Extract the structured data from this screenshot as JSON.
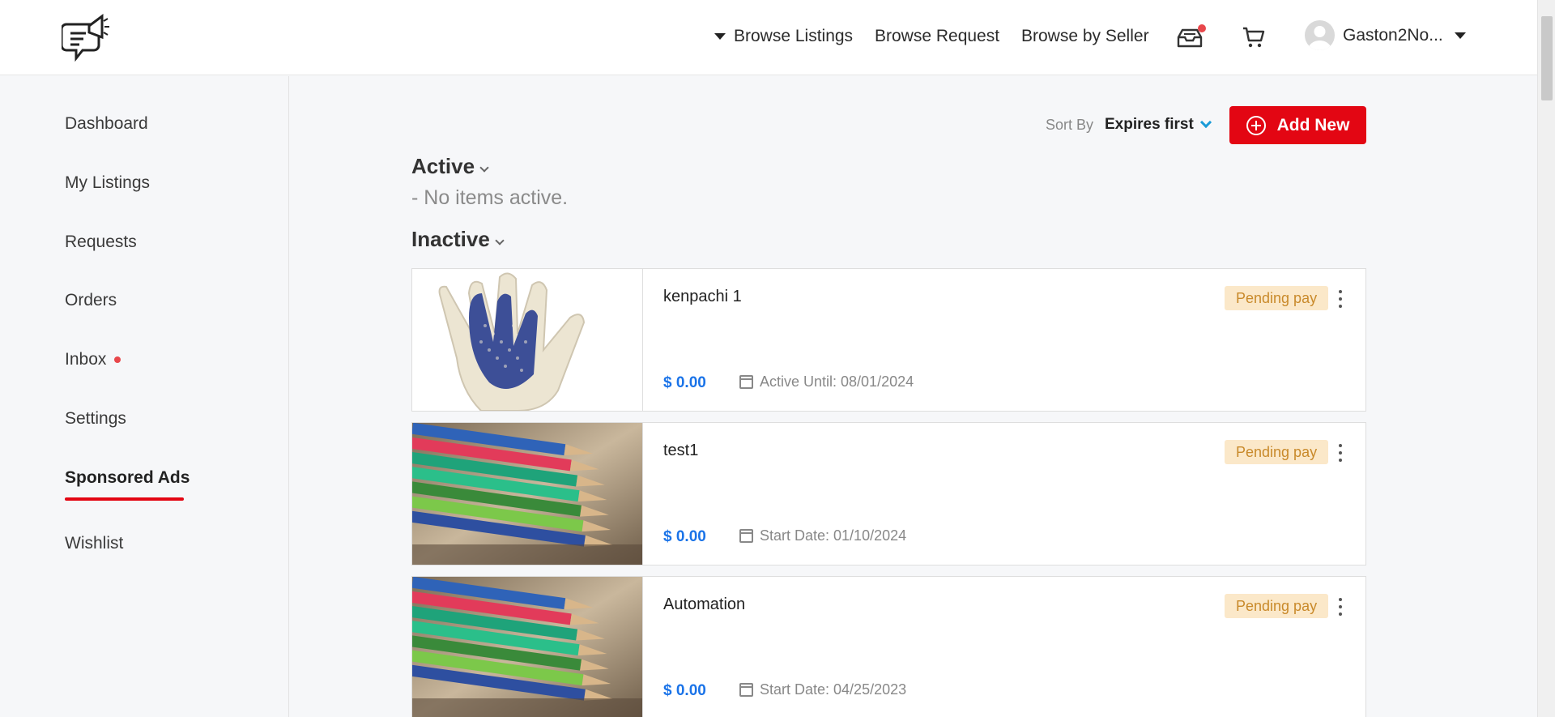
{
  "header": {
    "nav": {
      "browse_listings": "Browse Listings",
      "browse_request": "Browse Request",
      "browse_by_seller": "Browse by Seller"
    },
    "user_name": "Gaston2No...",
    "icons": [
      "logo-megaphone-icon",
      "inbox-tray-icon",
      "cart-icon",
      "avatar-icon",
      "caret-down-icon"
    ]
  },
  "sidebar": {
    "items": [
      {
        "label": "Dashboard"
      },
      {
        "label": "My Listings"
      },
      {
        "label": "Requests"
      },
      {
        "label": "Orders"
      },
      {
        "label": "Inbox"
      },
      {
        "label": "Settings"
      },
      {
        "label": "Sponsored Ads"
      },
      {
        "label": "Wishlist"
      }
    ],
    "active": "Sponsored Ads"
  },
  "toolbar": {
    "sort_label": "Sort By",
    "sort_value": "Expires first",
    "add_new_label": "Add New"
  },
  "sections": {
    "active": {
      "title": "Active",
      "empty": "- No items active."
    },
    "inactive": {
      "title": "Inactive"
    }
  },
  "listings": [
    {
      "title": "kenpachi 1",
      "price": "$ 0.00",
      "date": "Active Until: 08/01/2024",
      "status": "Pending pay",
      "image": "glove"
    },
    {
      "title": "test1",
      "price": "$ 0.00",
      "date": "Start Date: 01/10/2024",
      "status": "Pending pay",
      "image": "pencils"
    },
    {
      "title": "Automation",
      "price": "$ 0.00",
      "date": "Start Date: 04/25/2023",
      "status": "Pending pay",
      "image": "pencils"
    }
  ],
  "colors": {
    "accent_red": "#e30613",
    "price_blue": "#1a73e8",
    "badge_bg": "#fbe8c9",
    "badge_text": "#c98a2b",
    "sort_chevron": "#1a9bd7"
  }
}
